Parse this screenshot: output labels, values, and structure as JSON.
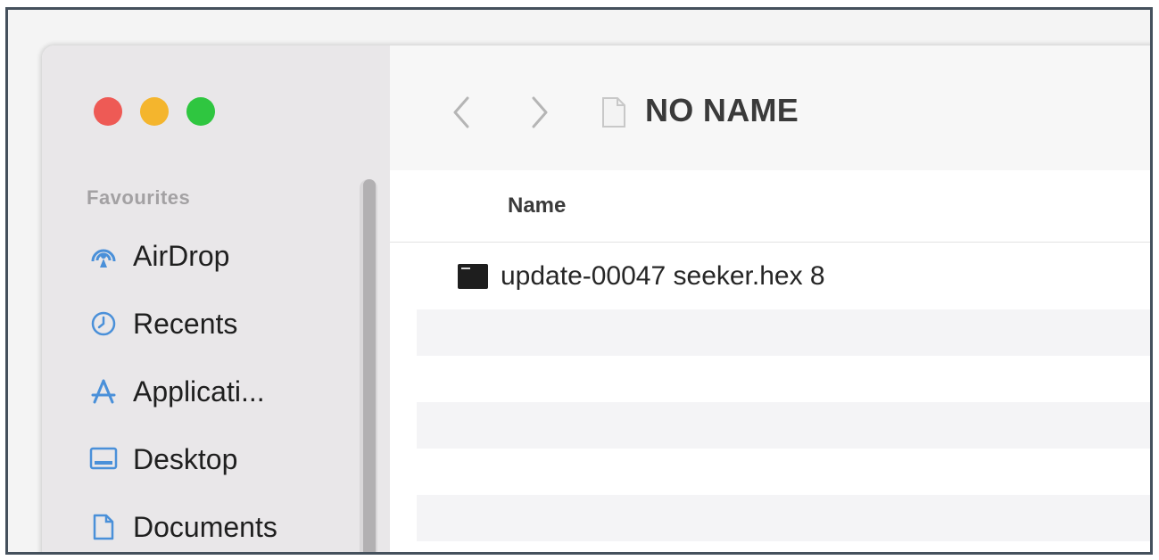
{
  "window": {
    "traffic_lights": {
      "close": "#ee5a55",
      "minimize": "#f4b52d",
      "zoom": "#2fc640"
    }
  },
  "sidebar": {
    "section_title": "Favourites",
    "items": [
      {
        "label": "AirDrop",
        "icon": "airdrop-icon"
      },
      {
        "label": "Recents",
        "icon": "clock-icon"
      },
      {
        "label": "Applicati...",
        "icon": "applications-icon"
      },
      {
        "label": "Desktop",
        "icon": "desktop-icon"
      },
      {
        "label": "Documents",
        "icon": "document-icon"
      }
    ]
  },
  "toolbar": {
    "back_icon": "chevron-left-icon",
    "forward_icon": "chevron-right-icon",
    "title": "NO NAME"
  },
  "file_list": {
    "columns": [
      "Name"
    ],
    "files": [
      {
        "name": "update-00047 seeker.hex 8",
        "icon": "executable-icon"
      }
    ]
  }
}
